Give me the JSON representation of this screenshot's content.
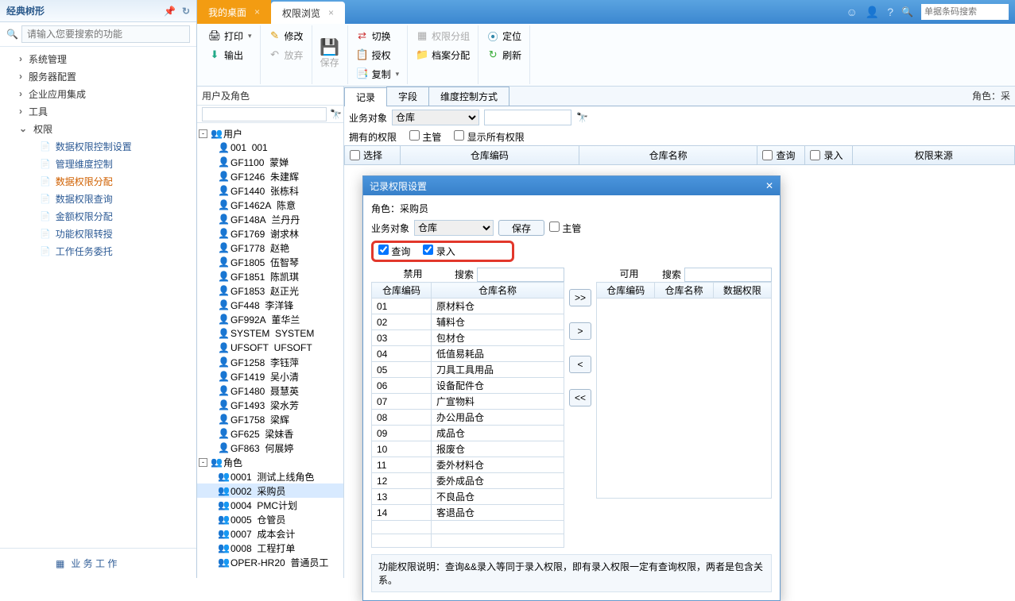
{
  "topbar": {
    "tab1": "我的桌面",
    "tab2": "权限浏览",
    "search_placeholder": "单据条码搜索"
  },
  "sidebar": {
    "title": "经典树形",
    "search_placeholder": "请输入您要搜索的功能",
    "items": [
      {
        "label": "系统管理",
        "expanded": false
      },
      {
        "label": "服务器配置",
        "expanded": false
      },
      {
        "label": "企业应用集成",
        "expanded": false
      },
      {
        "label": "工具",
        "expanded": false
      },
      {
        "label": "权限",
        "expanded": true
      }
    ],
    "sub_items": [
      "数据权限控制设置",
      "管理维度控制",
      "数据权限分配",
      "数据权限查询",
      "金额权限分配",
      "功能权限转授",
      "工作任务委托"
    ],
    "sub_selected": 2,
    "bottom": "业 务 工 作"
  },
  "toolbar": {
    "print": "打印",
    "output": "输出",
    "modify": "修改",
    "abandon": "放弃",
    "save": "保存",
    "switch": "切换",
    "auth": "授权",
    "copy": "复制",
    "perm_group": "权限分组",
    "file_alloc": "档案分配",
    "locate": "定位",
    "refresh": "刷新"
  },
  "user_panel": {
    "title": "用户及角色",
    "group_user": "用户",
    "group_role": "角色",
    "users": [
      {
        "code": "001",
        "name": "001"
      },
      {
        "code": "GF1100",
        "name": "蒙婵"
      },
      {
        "code": "GF1246",
        "name": "朱建辉"
      },
      {
        "code": "GF1440",
        "name": "张栋科"
      },
      {
        "code": "GF1462A",
        "name": "陈意"
      },
      {
        "code": "GF148A",
        "name": "兰丹丹"
      },
      {
        "code": "GF1769",
        "name": "谢求林"
      },
      {
        "code": "GF1778",
        "name": "赵艳"
      },
      {
        "code": "GF1805",
        "name": "伍智琴"
      },
      {
        "code": "GF1851",
        "name": "陈凯琪"
      },
      {
        "code": "GF1853",
        "name": "赵正光"
      },
      {
        "code": "GF448",
        "name": "李洋锋"
      },
      {
        "code": "GF992A",
        "name": "董华兰"
      },
      {
        "code": "SYSTEM",
        "name": "SYSTEM"
      },
      {
        "code": "UFSOFT",
        "name": "UFSOFT"
      },
      {
        "code": "GF1258",
        "name": "李钰萍"
      },
      {
        "code": "GF1419",
        "name": "吴小清"
      },
      {
        "code": "GF1480",
        "name": "聂慧英"
      },
      {
        "code": "GF1493",
        "name": "梁水芳"
      },
      {
        "code": "GF1758",
        "name": "梁辉"
      },
      {
        "code": "GF625",
        "name": "梁妹香"
      },
      {
        "code": "GF863",
        "name": "何展婷"
      }
    ],
    "roles": [
      {
        "code": "0001",
        "name": "测试上线角色"
      },
      {
        "code": "0002",
        "name": "采购员"
      },
      {
        "code": "0004",
        "name": "PMC计划"
      },
      {
        "code": "0005",
        "name": "仓管员"
      },
      {
        "code": "0007",
        "name": "成本会计"
      },
      {
        "code": "0008",
        "name": "工程打单"
      },
      {
        "code": "OPER-HR20",
        "name": "普通员工"
      }
    ],
    "role_selected": 1
  },
  "right": {
    "tabs": [
      "记录",
      "字段",
      "维度控制方式"
    ],
    "role_label": "角色：采",
    "biz_label": "业务对象",
    "biz_value": "仓库",
    "own_perm": "拥有的权限",
    "supervisor": "主管",
    "show_all": "显示所有权限",
    "cols": {
      "select": "选择",
      "code": "仓库编码",
      "name": "仓库名称",
      "query": "查询",
      "entry": "录入",
      "source": "权限来源"
    }
  },
  "dialog": {
    "title": "记录权限设置",
    "role_line": "角色：采购员",
    "biz_label": "业务对象",
    "biz_value": "仓库",
    "save": "保存",
    "supervisor": "主管",
    "query": "查询",
    "entry": "录入",
    "disable": "禁用",
    "available": "可用",
    "search": "搜索",
    "hdr_code": "仓库编码",
    "hdr_name": "仓库名称",
    "hdr_dataperm": "数据权限",
    "rows": [
      {
        "code": "01",
        "name": "原材料仓"
      },
      {
        "code": "02",
        "name": "辅料仓"
      },
      {
        "code": "03",
        "name": "包材仓"
      },
      {
        "code": "04",
        "name": "低值易耗品"
      },
      {
        "code": "05",
        "name": "刀具工具用品"
      },
      {
        "code": "06",
        "name": "设备配件仓"
      },
      {
        "code": "07",
        "name": "广宣物料"
      },
      {
        "code": "08",
        "name": "办公用品仓"
      },
      {
        "code": "09",
        "name": "成品仓"
      },
      {
        "code": "10",
        "name": "报废仓"
      },
      {
        "code": "11",
        "name": "委外材料仓"
      },
      {
        "code": "12",
        "name": "委外成品仓"
      },
      {
        "code": "13",
        "name": "不良品仓"
      },
      {
        "code": "14",
        "name": "客退品仓"
      }
    ],
    "btns": {
      "all_right": ">>",
      "right": ">",
      "left": "<",
      "all_left": "<<"
    },
    "foot": "功能权限说明：查询&&录入等同于录入权限，即有录入权限一定有查询权限，两者是包含关系。"
  }
}
